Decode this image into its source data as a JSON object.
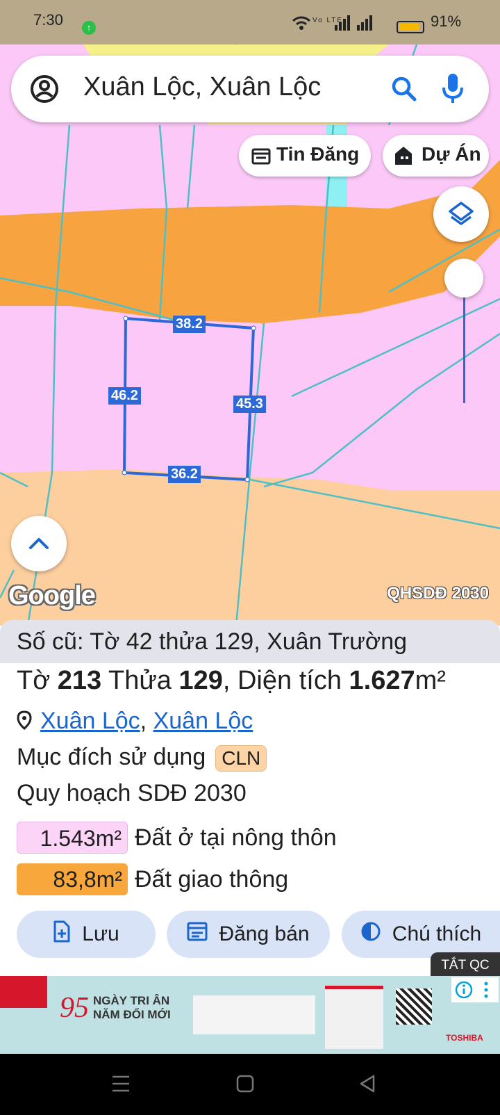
{
  "status_bar": {
    "time": "7:30",
    "battery": "91%",
    "network": "Vo LTE"
  },
  "search": {
    "query": "Xuân Lộc, Xuân Lộc"
  },
  "chips": {
    "listings": "Tin Đăng",
    "projects": "Dự Án"
  },
  "map": {
    "edge_labels": {
      "top": "38.2",
      "left": "46.2",
      "right": "45.3",
      "bottom": "36.2"
    },
    "plan_label": "QHSDĐ 2030",
    "logo": "Google"
  },
  "parcel": {
    "old_info": "Số cũ: Tờ 42 thửa 129, Xuân Trường",
    "sheet_label": "Tờ",
    "sheet_no": "213",
    "lot_label": "Thửa",
    "lot_no": "129",
    "area_label": ", Diện tích",
    "area_value": "1.627",
    "area_unit": "m²",
    "address_part1": "Xuân Lộc",
    "address_sep": ", ",
    "address_part2": "Xuân Lộc",
    "purpose_label": "Mục đích sử dụng",
    "purpose_code": "CLN",
    "plan_title": "Quy hoạch SDĐ 2030",
    "zones": [
      {
        "area": "1.543m²",
        "label": "Đất ở tại nông thôn",
        "color": "#fbd4f8"
      },
      {
        "area": "83,8m²",
        "label": "Đất giao thông",
        "color": "#f7a73c"
      }
    ]
  },
  "actions": {
    "save": "Lưu",
    "sell": "Đăng bán",
    "legend": "Chú thích"
  },
  "ad": {
    "close_label": "TẮT QC",
    "headline1": "NGÀY TRI ÂN",
    "headline2": "NĂM ĐỔI MỚI",
    "number": "95",
    "brand": "TOSHIBA"
  },
  "colors": {
    "residential": "#fbc8f7",
    "road": "#f7a440",
    "farmland": "#fdcf9f",
    "parcel_line": "#2c68d6",
    "river": "#8ff0f4"
  }
}
